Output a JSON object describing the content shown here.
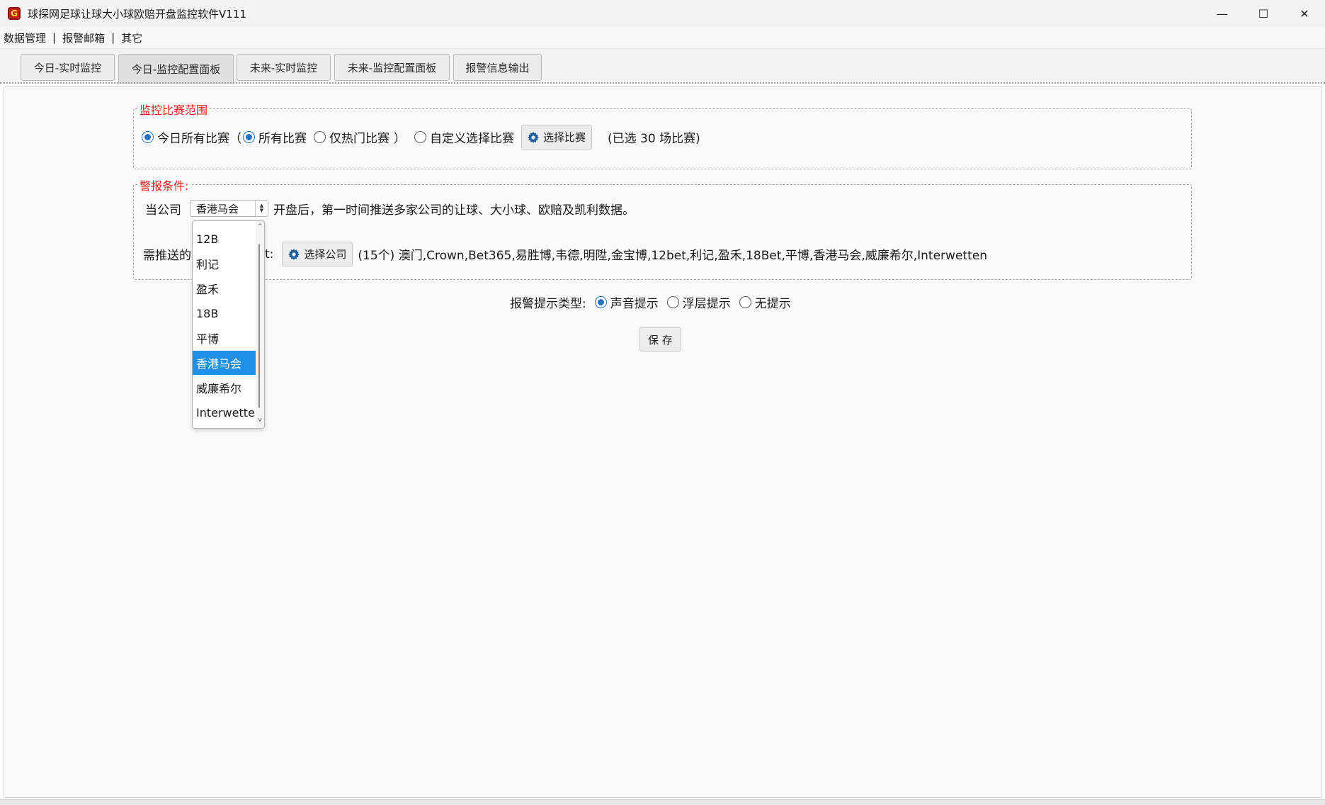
{
  "window": {
    "title": "球探网足球让球大小球欧赔开盘监控软件V111",
    "icon_label": "G",
    "minimize": "—",
    "maximize": "☐",
    "close": "✕"
  },
  "menu": {
    "items": [
      "数据管理",
      "报警邮箱",
      "其它"
    ],
    "separator": "|"
  },
  "tabs": [
    {
      "label": "今日-实时监控"
    },
    {
      "label": "今日-监控配置面板"
    },
    {
      "label": "未来-实时监控"
    },
    {
      "label": "未来-监控配置面板"
    },
    {
      "label": "报警信息输出"
    }
  ],
  "active_tab_index": 1,
  "scope": {
    "legend": "监控比赛范围",
    "today_all": "今日所有比赛",
    "open_paren": "（",
    "all_matches": "所有比赛",
    "hot_only": "仅热门比赛",
    "close_paren": "）",
    "custom": "自定义选择比赛",
    "select_button": "选择比赛",
    "selected_summary": "(已选  30  场比赛)",
    "today_all_checked": true,
    "all_matches_checked": true,
    "hot_only_checked": false,
    "custom_checked": false
  },
  "alarm": {
    "legend": "警报条件:",
    "company_prefix": "当公司",
    "company_selected": "香港马会",
    "condition_text": "开盘后，第一时间推送多家公司的让球、大小球、欧赔及凯利数据。",
    "push_label_visible_start": "需推送的",
    "push_label_visible_end": "t:",
    "select_company_button": "选择公司",
    "companies_summary": "(15个) 澳门,Crown,Bet365,易胜博,韦德,明陞,金宝博,12bet,利记,盈禾,18Bet,平博,香港马会,威廉希尔,Interwetten"
  },
  "dropdown": {
    "options": [
      "12B",
      "利记",
      "盈禾",
      "18B",
      "平博",
      "香港马会",
      "威廉希尔",
      "Interwetten"
    ],
    "selected_index": 5,
    "scroll_up": "^",
    "scroll_down": "v"
  },
  "alert_type": {
    "label": "报警提示类型:",
    "options": [
      {
        "label": "声音提示",
        "checked": true
      },
      {
        "label": "浮层提示",
        "checked": false
      },
      {
        "label": "无提示",
        "checked": false
      }
    ]
  },
  "save_button": "保 存",
  "colors": {
    "legend_red": "#e02020",
    "radio_blue": "#2673c4",
    "selected_blue": "#1e90e6"
  }
}
